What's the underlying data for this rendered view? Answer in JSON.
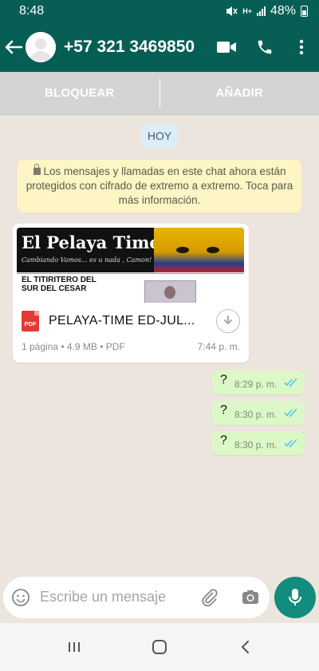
{
  "status_bar": {
    "time": "8:48",
    "battery": "48%",
    "signal_label": "H+"
  },
  "header": {
    "contact": "+57 321 3469850",
    "icons": [
      "back-arrow-icon",
      "avatar-icon",
      "video-call-icon",
      "phone-icon",
      "more-vert-icon"
    ],
    "color": "#075e54"
  },
  "action_bar": {
    "block_label": "BLOQUEAR",
    "add_label": "AÑADIR"
  },
  "chat": {
    "date_badge": "HOY",
    "encryption_notice": "Los mensajes y llamadas en este chat ahora están protegidos con cifrado de extremo a extremo. Toca para más información.",
    "document": {
      "preview_title": "El Pelaya Times",
      "preview_tagline": "Cambiando Vamos... es u nada , Camon!",
      "preview_headline_1": "EL TITIRITERO DEL",
      "preview_headline_2": "SUR DEL CESAR",
      "file_type_icon": "PDF",
      "file_name": "PELAYA-TIME ED-JUL...",
      "meta": "1 página • 4.9 MB • PDF",
      "time": "7:44 p. m."
    },
    "outgoing": [
      {
        "text": "?",
        "time": "8:29 p. m."
      },
      {
        "text": "?",
        "time": "8:30 p. m."
      },
      {
        "text": "?",
        "time": "8:30 p. m."
      }
    ],
    "read_tick_color": "#4fc3f7",
    "outgoing_bubble_color": "#dcf8c6"
  },
  "composer": {
    "placeholder": "Escribe un mensaje",
    "icons": [
      "emoji-icon",
      "attach-icon",
      "camera-icon",
      "mic-icon"
    ],
    "mic_color": "#128c7e"
  },
  "navigation": {
    "icons": [
      "recent-apps-icon",
      "home-icon",
      "back-icon"
    ]
  }
}
